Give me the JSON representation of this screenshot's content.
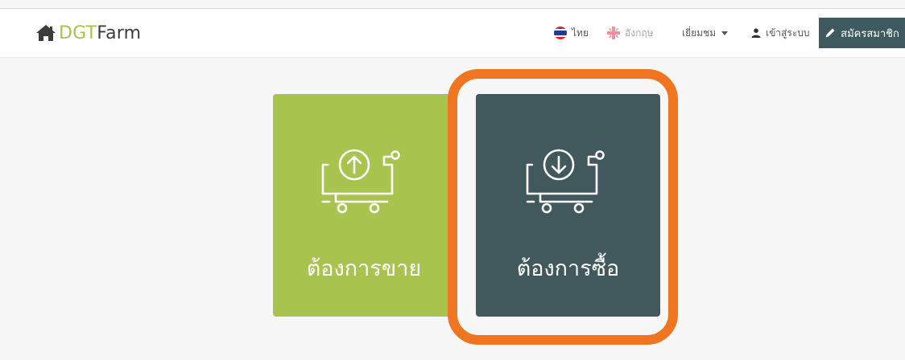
{
  "brand": {
    "part1": "DGT",
    "part2": "Farm"
  },
  "nav": {
    "lang_thai": "ไทย",
    "lang_english": "อังกฤษ",
    "browse": "เยี่ยมชม",
    "login": "เข้าสู่ระบบ",
    "signup": "สมัครสมาชิก"
  },
  "cards": {
    "sell": {
      "label": "ต้องการขาย",
      "icon": "cart-upload-icon"
    },
    "buy": {
      "label": "ต้องการซื้อ",
      "icon": "cart-download-icon"
    }
  },
  "colors": {
    "sell_card": "#a8c44f",
    "buy_card": "#41585c",
    "highlight": "#ef7520",
    "brand_green": "#a9c34a"
  }
}
